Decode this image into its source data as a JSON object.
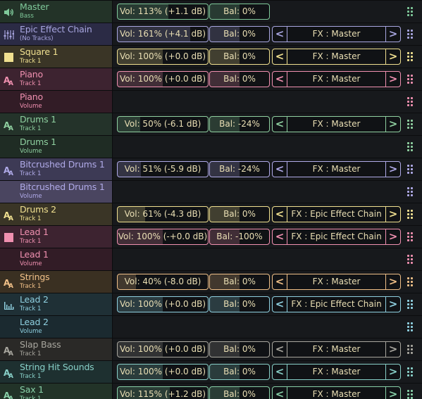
{
  "tracks": [
    {
      "name": "Master",
      "sub": "Bass",
      "icon": "speaker-icon",
      "bg": "#233328",
      "accent": "#7fc99a",
      "vol": "Vol: 113% (+1.1 dB)",
      "vol_fraction": 0.565,
      "bal": "Bal: 0%",
      "fx": null
    },
    {
      "name": "Epic Effect Chain",
      "sub": "(No Tracks)",
      "icon": "mixer-sliders-icon",
      "bg": "#2b2b45",
      "accent": "#a8a6e0",
      "vol": "Vol: 161% (+4.1 dB)",
      "vol_fraction": 0.805,
      "bal": "Bal: 0%",
      "fx": "FX : Master"
    },
    {
      "name": "Square 1",
      "sub": "Track 1",
      "icon": "square-wave-icon",
      "bg": "#3a3526",
      "accent": "#f0e090",
      "vol": "Vol: 100% (+0.0 dB)",
      "vol_fraction": 0.5,
      "bal": "Bal: 0%",
      "fx": "FX : Master"
    },
    {
      "name": "Piano",
      "sub": "Track 1",
      "icon": "instrument-icon",
      "bg": "#3d2330",
      "accent": "#f090b0",
      "vol": "Vol: 100% (+0.0 dB)",
      "vol_fraction": 0.5,
      "bal": "Bal: 0%",
      "fx": "FX : Master"
    },
    {
      "name": "Piano",
      "sub": "Volume",
      "icon": null,
      "bg": "#321c26",
      "accent": "#f090b0",
      "vol": null,
      "bal": null,
      "fx": null
    },
    {
      "name": "Drums 1",
      "sub": "Track 1",
      "icon": "instrument-icon",
      "bg": "#24332a",
      "accent": "#8fd0a0",
      "vol": "Vol: 50% (-6.1 dB)",
      "vol_fraction": 0.25,
      "bal": "Bal: -24%",
      "fx": "FX : Master"
    },
    {
      "name": "Drums 1",
      "sub": "Volume",
      "icon": null,
      "bg": "#1f2c24",
      "accent": "#8fd0a0",
      "vol": null,
      "bal": null,
      "fx": null
    },
    {
      "name": "Bitcrushed Drums 1",
      "sub": "Track 1",
      "icon": "instrument-icon",
      "bg": "#3d3a55",
      "accent": "#b0aae8",
      "vol": "Vol: 51% (-5.9 dB)",
      "vol_fraction": 0.255,
      "bal": "Bal: -24%",
      "fx": "FX : Master"
    },
    {
      "name": "Bitcrushed Drums 1",
      "sub": "Volume",
      "icon": null,
      "bg": "#4a4560",
      "accent": "#b0aae8",
      "vol": null,
      "bal": null,
      "fx": null
    },
    {
      "name": "Drums 2",
      "sub": "Track 1",
      "icon": "instrument-icon",
      "bg": "#3a3526",
      "accent": "#f0e090",
      "vol": "Vol: 61% (-4.3 dB)",
      "vol_fraction": 0.305,
      "bal": "Bal: 0%",
      "fx": "FX : Epic Effect Chain"
    },
    {
      "name": "Lead 1",
      "sub": "Track 1",
      "icon": "square-wave-icon",
      "bg": "#3d2330",
      "accent": "#f090b0",
      "vol": "Vol: 100% (-+0.0 dB)",
      "vol_fraction": 0.5,
      "bal": "Bal: -100%",
      "fx": "FX : Epic Effect Chain"
    },
    {
      "name": "Lead 1",
      "sub": "Volume",
      "icon": null,
      "bg": "#321c26",
      "accent": "#f090b0",
      "vol": null,
      "bal": null,
      "fx": null
    },
    {
      "name": "Strings",
      "sub": "Track 1",
      "icon": "instrument-icon",
      "bg": "#3a3022",
      "accent": "#f0c088",
      "vol": "Vol: 40% (-8.0 dB)",
      "vol_fraction": 0.2,
      "bal": "Bal: 0%",
      "fx": "FX : Master"
    },
    {
      "name": "Lead 2",
      "sub": "Track 1",
      "icon": "equalizer-icon",
      "bg": "#1f3036",
      "accent": "#8fd0e0",
      "vol": "Vol: 100% (+0.0 dB)",
      "vol_fraction": 0.5,
      "bal": "Bal: 0%",
      "fx": "FX : Epic Effect Chain"
    },
    {
      "name": "Lead 2",
      "sub": "Volume",
      "icon": null,
      "bg": "#1b2a30",
      "accent": "#8fd0e0",
      "vol": null,
      "bal": null,
      "fx": null
    },
    {
      "name": "Slap Bass",
      "sub": "Track 1",
      "icon": "instrument-icon",
      "bg": "#2a2927",
      "accent": "#a8a69e",
      "vol": "Vol: 100% (+0.0 dB)",
      "vol_fraction": 0.5,
      "bal": "Bal: 0%",
      "fx": "FX : Master"
    },
    {
      "name": "String Hit Sounds",
      "sub": "Track 1",
      "icon": "instrument-icon",
      "bg": "#1e3030",
      "accent": "#88d0c8",
      "vol": "Vol: 100% (+0.0 dB)",
      "vol_fraction": 0.5,
      "bal": "Bal: 0%",
      "fx": "FX : Master"
    },
    {
      "name": "Sax 1",
      "sub": "Track 1",
      "icon": "instrument-icon",
      "bg": "#223328",
      "accent": "#88d0a8",
      "vol": "Vol: 115% (+1.2 dB)",
      "vol_fraction": 0.575,
      "bal": "Bal: 0%",
      "fx": "FX : Master"
    }
  ],
  "arrows": {
    "prev": "<",
    "next": ">"
  },
  "colors": {
    "text": "#eadfb4",
    "divider": "#0b0c0e",
    "panel": "#141619"
  }
}
